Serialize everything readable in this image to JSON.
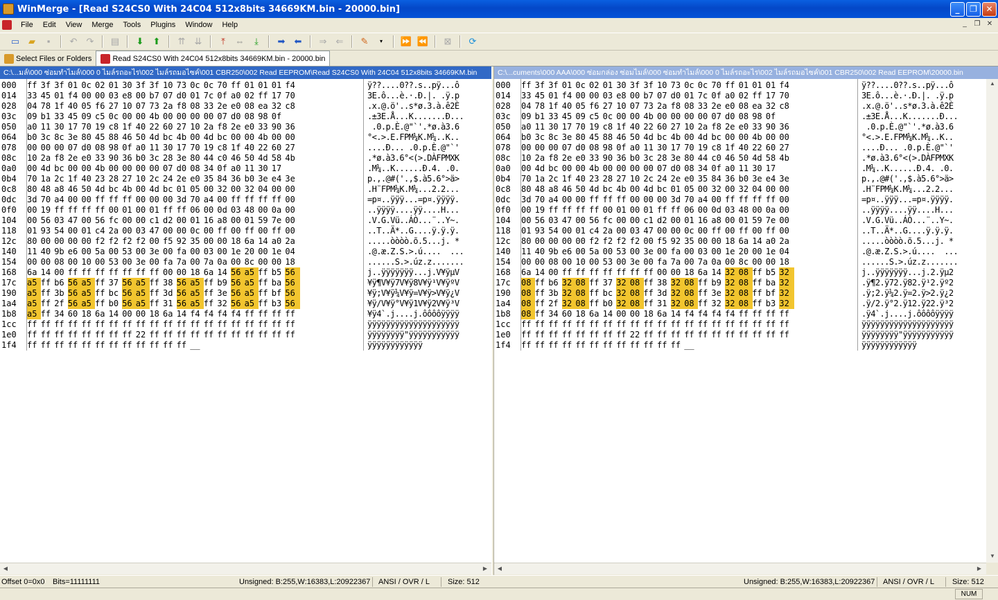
{
  "window": {
    "title": "WinMerge - [Read S24CS0 With 24C04 512x8bits 34669KM.bin - 20000.bin]"
  },
  "menu": [
    "File",
    "Edit",
    "View",
    "Merge",
    "Tools",
    "Plugins",
    "Window",
    "Help"
  ],
  "tabs": [
    {
      "label": "Select Files or Folders"
    },
    {
      "label": "Read S24CS0 With 24C04 512x8bits 34669KM.bin - 20000.bin"
    }
  ],
  "left": {
    "path": "C:\\...มล์\\000 ซ่อมทำไมล์\\000 0 ไมล์รถอะไร\\002 ไมล์รถมอไซค์\\001 CBR250\\002 Read EEPROM\\Read S24CS0 With 24C04 512x8bits 34669KM.bin",
    "rows": [
      {
        "off": "000",
        "hex": "ff 3f 3f 01 0c 02 01 30 3f 3f 10 73 0c 0c 70 ff 01 01 01 f4",
        "asc": "ÿ??....0??.s..pÿ...ô"
      },
      {
        "off": "014",
        "hex": "33 45 01 f4 00 00 03 e8 00 b7 07 d0 01 7c 0f a0 02 ff 17 70",
        "asc": "3E.ô...è.·.Ð.|. .ÿ.p"
      },
      {
        "off": "028",
        "hex": "04 78 1f 40 05 f6 27 10 07 73 2a f8 08 33 2e e0 08 ea 32 c8",
        "asc": ".x.@.ö'..s*ø.3.à.ê2È"
      },
      {
        "off": "03c",
        "hex": "09 b1 33 45 09 c5 0c 00 00 4b 00 00 00 00 07 d0 08 98 0f",
        "asc": ".±3E.Å...K.......Ð..."
      },
      {
        "off": "050",
        "hex": "a0 11 30 17 70 19 c8 1f 40 22 60 27 10 2a f8 2e e0 33 90 36",
        "asc": " .0.p.È.@\"`'.*ø.à3.6"
      },
      {
        "off": "064",
        "hex": "b0 3c 8c 3e 80 45 88 46 50 4d bc 4b 00 4d bc 00 00 4b 00 00",
        "asc": "°<.>.E.FPM¼K.M¼..K.."
      },
      {
        "off": "078",
        "hex": "00 00 00 07 d0 08 98 0f a0 11 30 17 70 19 c8 1f 40 22 60 27",
        "asc": "....Ð... .0.p.È.@\"`'"
      },
      {
        "off": "08c",
        "hex": "10 2a f8 2e e0 33 90 36 b0 3c 28 3e 80 44 c0 46 50 4d 58 4b",
        "asc": ".*ø.à3.6°<(>.DÀFPMXK"
      },
      {
        "off": "0a0",
        "hex": "00 4d bc 00 00 4b 00 00 00 00 07 d0 08 34 0f a0 11 30 17",
        "asc": ".M¼..K......Ð.4. .0."
      },
      {
        "off": "0b4",
        "hex": "70 1a 2c 1f 40 23 28 27 10 2c 24 2e e0 35 84 36 b0 3e e4 3e",
        "asc": "p.,.@#('.,$.à5.6°>ä>"
      },
      {
        "off": "0c8",
        "hex": "80 48 a8 46 50 4d bc 4b 00 4d bc 01 05 00 32 00 32 04 00 00",
        "asc": ".H¨FPM¼K.M¼...2.2..."
      },
      {
        "off": "0dc",
        "hex": "3d 70 a4 00 00 ff ff ff 00 00 00 3d 70 a4 00 ff ff ff ff 00",
        "asc": "=p¤..ÿÿÿ...=p¤.ÿÿÿÿ."
      },
      {
        "off": "0f0",
        "hex": "00 19 ff ff ff ff 00 01 00 01 ff ff 06 00 0d 03 48 00 0a 00",
        "asc": "..ÿÿÿÿ....ÿÿ....H..."
      },
      {
        "off": "104",
        "hex": "00 56 03 47 00 56 fc 00 00 c1 d2 00 01 16 a8 00 01 59 7e 00",
        "asc": ".V.G.Vü..ÁÒ...¨..Y~."
      },
      {
        "off": "118",
        "hex": "01 93 54 00 01 c4 2a 00 03 47 00 00 0c 00 ff 00 ff 00 ff 00",
        "asc": "..T..Ä*..G....ÿ.ÿ.ÿ."
      },
      {
        "off": "12c",
        "hex": "80 00 00 00 00 f2 f2 f2 f2 00 f5 92 35 00 00 18 6a 14 a0 2a",
        "asc": ".....òòòò.õ.5...j. *"
      },
      {
        "off": "140",
        "hex": "11 40 9b e6 00 5a 00 53 00 3e 00 fa 00 03 00 1e 20 00 1e 04",
        "asc": ".@.æ.Z.S.>.ú....  ..."
      },
      {
        "off": "154",
        "hex": "00 00 08 00 10 00 53 00 3e 00 fa 7a 00 7a 0a 00 8c 00 00 18",
        "asc": "......S.>.úz.z......."
      },
      {
        "off": "168",
        "hex": "6a 14 00 ff ff ff ff ff ff ff 00 00 18 6a 14 56 a5 ff b5 56",
        "asc": "j..ÿÿÿÿÿÿÿ...j.V¥ÿµV"
      },
      {
        "off": "17c",
        "hex": "a5 ff b6 56 a5 ff 37 56 a5 ff 38 56 a5 ff b9 56 a5 ff ba 56",
        "asc": "¥ÿ¶V¥ÿ7V¥ÿ8V¥ÿ¹V¥ÿºV"
      },
      {
        "off": "190",
        "hex": "a5 ff 3b 56 a5 ff bc 56 a5 ff 3d 56 a5 ff 3e 56 a5 ff bf 56",
        "asc": "¥ÿ;V¥ÿ¼V¥ÿ=V¥ÿ>V¥ÿ¿V"
      },
      {
        "off": "1a4",
        "hex": "a5 ff 2f 56 a5 ff b0 56 a5 ff 31 56 a5 ff 32 56 a5 ff b3 56",
        "asc": "¥ÿ/V¥ÿ°V¥ÿ1V¥ÿ2V¥ÿ³V"
      },
      {
        "off": "1b8",
        "hex": "a5 ff 34 60 18 6a 14 00 00 18 6a 14 f4 f4 f4 f4 ff ff ff ff",
        "asc": "¥ÿ4`.j....j.ôôôôÿÿÿÿ"
      },
      {
        "off": "1cc",
        "hex": "ff ff ff ff ff ff ff ff ff ff ff ff ff ff ff ff ff ff ff ff",
        "asc": "ÿÿÿÿÿÿÿÿÿÿÿÿÿÿÿÿÿÿÿÿ"
      },
      {
        "off": "1e0",
        "hex": "ff ff ff ff ff ff ff ff 22 ff ff ff ff ff ff ff ff ff ff ff",
        "asc": "ÿÿÿÿÿÿÿÿ\"ÿÿÿÿÿÿÿÿÿÿÿ"
      },
      {
        "off": "1f4",
        "hex": "ff ff ff ff ff ff ff ff ff ff ff ff __",
        "asc": "ÿÿÿÿÿÿÿÿÿÿÿÿ"
      }
    ]
  },
  "right": {
    "path": "C:\\...cuments\\000 AAA\\000 ซ่อมกล่อง ซ่อมไมล์\\000 ซ่อมทำไมล์\\000 0 ไมล์รถอะไร\\002 ไมล์รถมอไซค์\\001 CBR250\\002 Read EEPROM\\20000.bin",
    "rows": [
      {
        "off": "000",
        "hex": "ff 3f 3f 01 0c 02 01 30 3f 3f 10 73 0c 0c 70 ff 01 01 01 f4",
        "asc": "ÿ??....0??.s..pÿ...ô"
      },
      {
        "off": "014",
        "hex": "33 45 01 f4 00 00 03 e8 00 b7 07 d0 01 7c 0f a0 02 ff 17 70",
        "asc": "3E.ô...è.·.Ð.|. .ÿ.p"
      },
      {
        "off": "028",
        "hex": "04 78 1f 40 05 f6 27 10 07 73 2a f8 08 33 2e e0 08 ea 32 c8",
        "asc": ".x.@.ö'..s*ø.3.à.ê2È"
      },
      {
        "off": "03c",
        "hex": "09 b1 33 45 09 c5 0c 00 00 4b 00 00 00 00 07 d0 08 98 0f",
        "asc": ".±3E.Å...K.......Ð..."
      },
      {
        "off": "050",
        "hex": "a0 11 30 17 70 19 c8 1f 40 22 60 27 10 2a f8 2e e0 33 90 36",
        "asc": " .0.p.È.@\"`'.*ø.à3.6"
      },
      {
        "off": "064",
        "hex": "b0 3c 8c 3e 80 45 88 46 50 4d bc 4b 00 4d bc 00 00 4b 00 00",
        "asc": "°<.>.E.FPM¼K.M¼..K.."
      },
      {
        "off": "078",
        "hex": "00 00 00 07 d0 08 98 0f a0 11 30 17 70 19 c8 1f 40 22 60 27",
        "asc": "....Ð... .0.p.È.@\"`'"
      },
      {
        "off": "08c",
        "hex": "10 2a f8 2e e0 33 90 36 b0 3c 28 3e 80 44 c0 46 50 4d 58 4b",
        "asc": ".*ø.à3.6°<(>.DÀFPMXK"
      },
      {
        "off": "0a0",
        "hex": "00 4d bc 00 00 4b 00 00 00 00 07 d0 08 34 0f a0 11 30 17",
        "asc": ".M¼..K......Ð.4. .0."
      },
      {
        "off": "0b4",
        "hex": "70 1a 2c 1f 40 23 28 27 10 2c 24 2e e0 35 84 36 b0 3e e4 3e",
        "asc": "p.,.@#('.,$.à5.6°>ä>"
      },
      {
        "off": "0c8",
        "hex": "80 48 a8 46 50 4d bc 4b 00 4d bc 01 05 00 32 00 32 04 00 00",
        "asc": ".H¨FPM¼K.M¼...2.2..."
      },
      {
        "off": "0dc",
        "hex": "3d 70 a4 00 00 ff ff ff 00 00 00 3d 70 a4 00 ff ff ff ff 00",
        "asc": "=p¤..ÿÿÿ...=p¤.ÿÿÿÿ."
      },
      {
        "off": "0f0",
        "hex": "00 19 ff ff ff ff 00 01 00 01 ff ff 06 00 0d 03 48 00 0a 00",
        "asc": "..ÿÿÿÿ....ÿÿ....H..."
      },
      {
        "off": "104",
        "hex": "00 56 03 47 00 56 fc 00 00 c1 d2 00 01 16 a8 00 01 59 7e 00",
        "asc": ".V.G.Vü..ÁÒ...¨..Y~."
      },
      {
        "off": "118",
        "hex": "01 93 54 00 01 c4 2a 00 03 47 00 00 0c 00 ff 00 ff 00 ff 00",
        "asc": "..T..Ä*..G....ÿ.ÿ.ÿ."
      },
      {
        "off": "12c",
        "hex": "80 00 00 00 00 f2 f2 f2 f2 00 f5 92 35 00 00 18 6a 14 a0 2a",
        "asc": ".....òòòò.õ.5...j. *"
      },
      {
        "off": "140",
        "hex": "11 40 9b e6 00 5a 00 53 00 3e 00 fa 00 03 00 1e 20 00 1e 04",
        "asc": ".@.æ.Z.S.>.ú....  ..."
      },
      {
        "off": "154",
        "hex": "00 00 08 00 10 00 53 00 3e 00 fa 7a 00 7a 0a 00 8c 00 00 18",
        "asc": "......S.>.úz.z......."
      },
      {
        "off": "168",
        "hex": "6a 14 00 ff ff ff ff ff ff ff 00 00 18 6a 14 32 08 ff b5 32",
        "asc": "j..ÿÿÿÿÿÿÿ...j.2.ÿµ2"
      },
      {
        "off": "17c",
        "hex": "08 ff b6 32 08 ff 37 32 08 ff 38 32 08 ff b9 32 08 ff ba 32",
        "asc": ".ÿ¶2.ÿ72.ÿ82.ÿ¹2.ÿº2"
      },
      {
        "off": "190",
        "hex": "08 ff 3b 32 08 ff bc 32 08 ff 3d 32 08 ff 3e 32 08 ff bf 32",
        "asc": ".ÿ;2.ÿ¼2.ÿ=2.ÿ>2.ÿ¿2"
      },
      {
        "off": "1a4",
        "hex": "08 ff 2f 32 08 ff b0 32 08 ff 31 32 08 ff 32 32 08 ff b3 32",
        "asc": ".ÿ/2.ÿ°2.ÿ12.ÿ22.ÿ³2"
      },
      {
        "off": "1b8",
        "hex": "08 ff 34 60 18 6a 14 00 00 18 6a 14 f4 f4 f4 f4 ff ff ff ff",
        "asc": ".ÿ4`.j....j.ôôôôÿÿÿÿ"
      },
      {
        "off": "1cc",
        "hex": "ff ff ff ff ff ff ff ff ff ff ff ff ff ff ff ff ff ff ff ff",
        "asc": "ÿÿÿÿÿÿÿÿÿÿÿÿÿÿÿÿÿÿÿÿ"
      },
      {
        "off": "1e0",
        "hex": "ff ff ff ff ff ff ff ff 22 ff ff ff ff ff ff ff ff ff ff ff",
        "asc": "ÿÿÿÿÿÿÿÿ\"ÿÿÿÿÿÿÿÿÿÿÿ"
      },
      {
        "off": "1f4",
        "hex": "ff ff ff ff ff ff ff ff ff ff ff ff __",
        "asc": "ÿÿÿÿÿÿÿÿÿÿÿÿ"
      }
    ]
  },
  "diff": {
    "color": "#f2c52f",
    "rows": {
      "18": [
        15,
        16,
        19
      ],
      "19": [
        0,
        3,
        4,
        7,
        8,
        11,
        12,
        15,
        16,
        19
      ],
      "20": [
        0,
        3,
        4,
        7,
        8,
        11,
        12,
        15,
        16,
        19
      ],
      "21": [
        0,
        3,
        4,
        7,
        8,
        11,
        12,
        15,
        16,
        19
      ],
      "22": [
        0
      ]
    }
  },
  "status": {
    "offset": "Offset 0=0x0",
    "bits": "Bits=11111111",
    "unsigned_left": "Unsigned: B:255,W:16383,L:20922367",
    "mode_left": "ANSI / OVR / L",
    "size_left": "Size: 512",
    "unsigned_right": "Unsigned: B:255,W:16383,L:20922367",
    "mode_right": "ANSI / OVR / L",
    "size_right": "Size: 512",
    "num": "NUM"
  }
}
